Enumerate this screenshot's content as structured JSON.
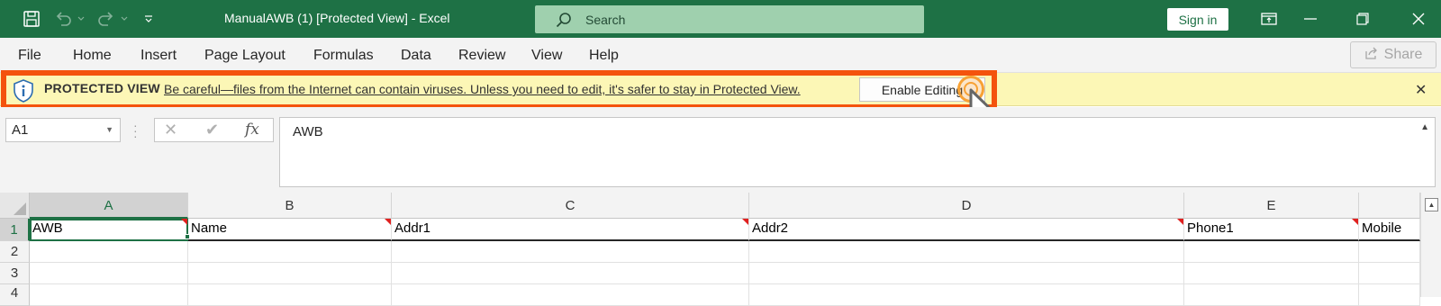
{
  "titlebar": {
    "doc_title": "ManualAWB (1)  [Protected View]  -  Excel",
    "search_placeholder": "Search",
    "signin_label": "Sign in"
  },
  "menu": {
    "items": [
      "File",
      "Home",
      "Insert",
      "Page Layout",
      "Formulas",
      "Data",
      "Review",
      "View",
      "Help"
    ],
    "share_label": "Share"
  },
  "protected_view": {
    "title": "PROTECTED VIEW",
    "message": "Be careful—files from the Internet can contain viruses. Unless you need to edit, it's safer to stay in Protected View.",
    "enable_button": "Enable Editing",
    "close_glyph": "✕"
  },
  "formula_bar": {
    "name_box": "A1",
    "fx_label": "fx",
    "content": "AWB"
  },
  "grid": {
    "columns": [
      "A",
      "B",
      "C",
      "D",
      "E",
      ""
    ],
    "rows": [
      "1",
      "2",
      "3",
      "4"
    ],
    "header_row": [
      "AWB",
      "Name",
      "Addr1",
      "Addr2",
      "Phone1",
      "Mobile"
    ],
    "active_cell": "A1"
  },
  "colors": {
    "brand_green": "#1e7145",
    "protected_bar": "#fcf7b6",
    "highlight_orange": "#f4530d"
  }
}
